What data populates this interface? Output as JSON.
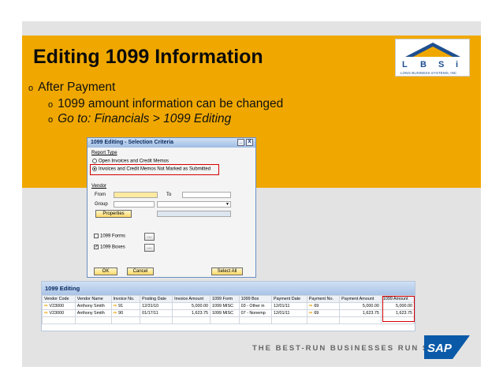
{
  "slide": {
    "title": "Editing 1099 Information",
    "bullets": [
      {
        "level": 1,
        "marker": "o",
        "text": "After Payment"
      },
      {
        "level": 2,
        "marker": "o",
        "text": "1099 amount information can be changed"
      },
      {
        "level": 2,
        "marker": "o",
        "text": "Go to: Financials > 1099 Editing"
      }
    ],
    "logo": {
      "letters": [
        "L",
        "B",
        "S",
        "i"
      ],
      "text": "LONG BUSINESS SYSTEMS, INC"
    },
    "tagline": "THE BEST-RUN BUSINESSES RUN SAP",
    "sap_logo": "SAP"
  },
  "dialog": {
    "title": "1099 Editing - Selection Criteria",
    "report_type_label": "Report Type",
    "option_open": "Open Invoices and Credit Memos",
    "option_not_submitted": "Invoices and Credit Memos Not Marked as Submitted",
    "vendor_label": "Vendor",
    "from_label": "From",
    "to_label": "To",
    "group_label": "Group",
    "properties_button": "Properties",
    "forms_label": "1099 Forms",
    "boxes_label": "1099 Boxes",
    "ellipsis": "...",
    "ok_button": "OK",
    "cancel_button": "Cancel",
    "select_all_button": "Select All",
    "minimize_glyph": "_",
    "close_glyph": "X"
  },
  "grid": {
    "title": "1099 Editing",
    "columns": [
      "Vendor Code",
      "Vendor Name",
      "Invoice No.",
      "Posting Date",
      "Invoice Amount",
      "1099 Form",
      "1099 Box",
      "Payment Date",
      "Payment No.",
      "Payment Amount",
      "1099 Amount"
    ],
    "rows": [
      [
        "V23000",
        "Anthony Smith",
        "91",
        "12/31/10",
        "5,000.00",
        "1099 MISC",
        "03 - Other in",
        "12/01/11",
        "69",
        "5,000.00",
        "5,000.00"
      ],
      [
        "V23000",
        "Anthony Smith",
        "90",
        "01/17/11",
        "1,623.75",
        "1099 MISC",
        "07 - Nonemp",
        "12/01/11",
        "69",
        "1,623.75",
        "1,623.75"
      ]
    ]
  },
  "colors": {
    "gold": "#f0a800",
    "highlight": "#d40000",
    "sap_blue": "#0a5aa8"
  }
}
